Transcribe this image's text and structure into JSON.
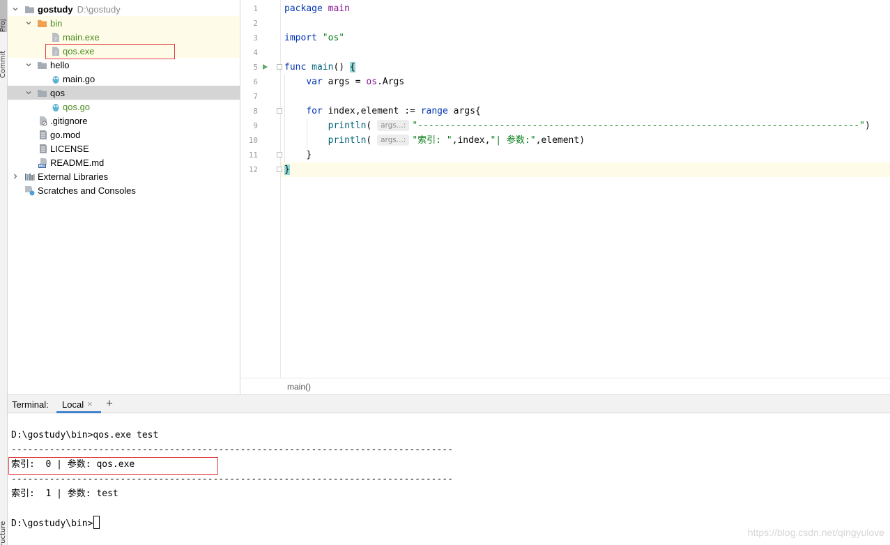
{
  "tool_stripe": {
    "project_tab": "Proj",
    "commit_tab": "Commit",
    "structure_tab": "ructure"
  },
  "project_tree": {
    "root_name": "gostudy",
    "root_path": "D:\\gostudy",
    "bin_folder": "bin",
    "bin_main_exe": "main.exe",
    "bin_qos_exe": "qos.exe",
    "hello_folder": "hello",
    "hello_main_go": "main.go",
    "qos_folder": "qos",
    "qos_go": "qos.go",
    "gitignore": ".gitignore",
    "go_mod": "go.mod",
    "license": "LICENSE",
    "readme": "README.md",
    "external_libraries": "External Libraries",
    "scratches": "Scratches and Consoles"
  },
  "editor": {
    "line_numbers": [
      "1",
      "2",
      "3",
      "4",
      "5",
      "6",
      "7",
      "8",
      "9",
      "10",
      "11",
      "12"
    ],
    "code": {
      "kw_package": "package",
      "pkg_main": "main",
      "kw_import": "import",
      "import_os": "\"os\"",
      "kw_func": "func",
      "fn_main": "main",
      "fn_parens": "() ",
      "open_brace": "{",
      "kw_var": "var",
      "args_assign": " args = ",
      "pkg_os": "os",
      "args_field": ".Args",
      "kw_for": "for",
      "for_vars": " index,element := ",
      "kw_range": "range",
      "range_target": " args{",
      "fn_println": "println",
      "paren_open": "(",
      "param_hint": "args...:",
      "dash_string": "\"---------------------------------------------------------------------------------\"",
      "paren_close": ")",
      "index_label_string": "\"索引: \"",
      "index_arg": ",index,",
      "param_label_string": "\"| 参数:\"",
      "element_arg": ",element)",
      "close_for": "}",
      "close_main": "}"
    },
    "breadcrumb": "main()"
  },
  "terminal": {
    "title": "Terminal:",
    "tab_label": "Local",
    "close_glyph": "×",
    "new_tab_glyph": "+",
    "command_line": "D:\\gostudy\\bin>qos.exe test",
    "separator_1": "---------------------------------------------------------------------------------",
    "output_1": "索引:  0 | 参数: qos.exe",
    "separator_2": "---------------------------------------------------------------------------------",
    "output_2": "索引:  1 | 参数: test",
    "prompt": "D:\\gostudy\\bin>"
  },
  "watermark": "https://blog.csdn.net/qingyulove",
  "colors": {
    "accent": "#4083c9",
    "highlight_box": "#e23b3b",
    "run_icon": "#59a869",
    "folder_orange": "#f0a050",
    "folder_gray": "#a4abb5"
  }
}
